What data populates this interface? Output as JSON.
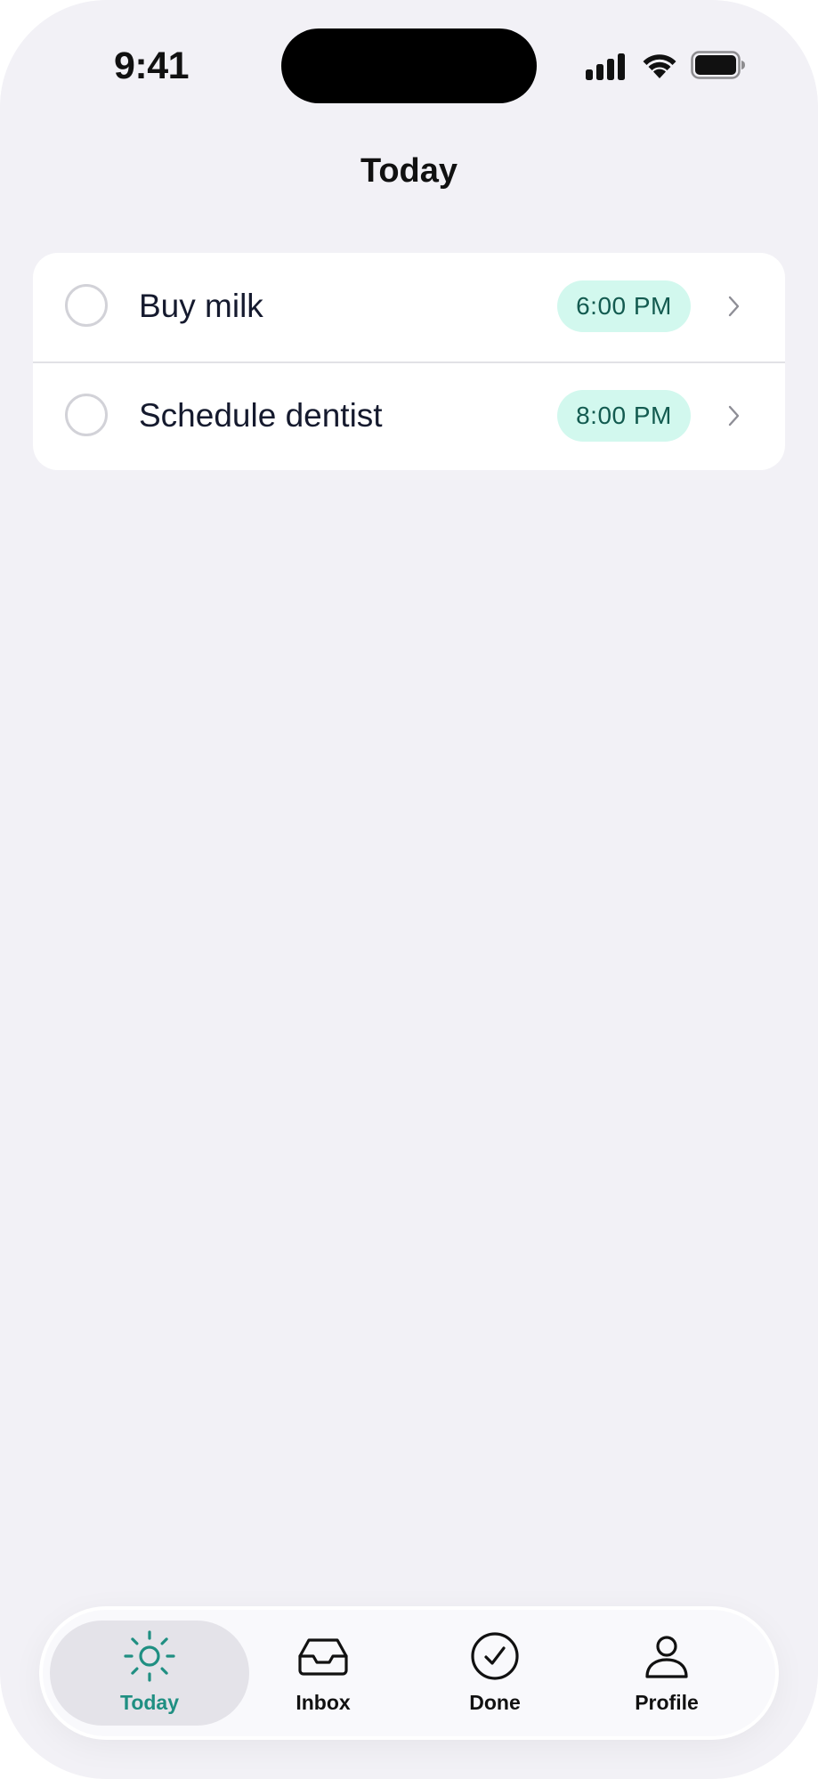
{
  "status_bar": {
    "time": "9:41",
    "icons": [
      "cellular-signal-icon",
      "wifi-icon",
      "battery-icon"
    ]
  },
  "nav": {
    "title": "Today"
  },
  "tasks": [
    {
      "title": "Buy milk",
      "time": "6:00 PM",
      "completed": false
    },
    {
      "title": "Schedule dentist",
      "time": "8:00 PM",
      "completed": false
    }
  ],
  "tab_bar": {
    "items": [
      {
        "label": "Today",
        "icon": "sun-icon",
        "active": true
      },
      {
        "label": "Inbox",
        "icon": "inbox-tray-icon",
        "active": false
      },
      {
        "label": "Done",
        "icon": "check-circle-icon",
        "active": false
      },
      {
        "label": "Profile",
        "icon": "person-icon",
        "active": false
      }
    ]
  },
  "colors": {
    "accent": "#1f8f82",
    "pill_background": "#d2f8ee",
    "pill_text": "#135b50",
    "background": "#f2f1f6",
    "text_primary": "#151a2e"
  }
}
